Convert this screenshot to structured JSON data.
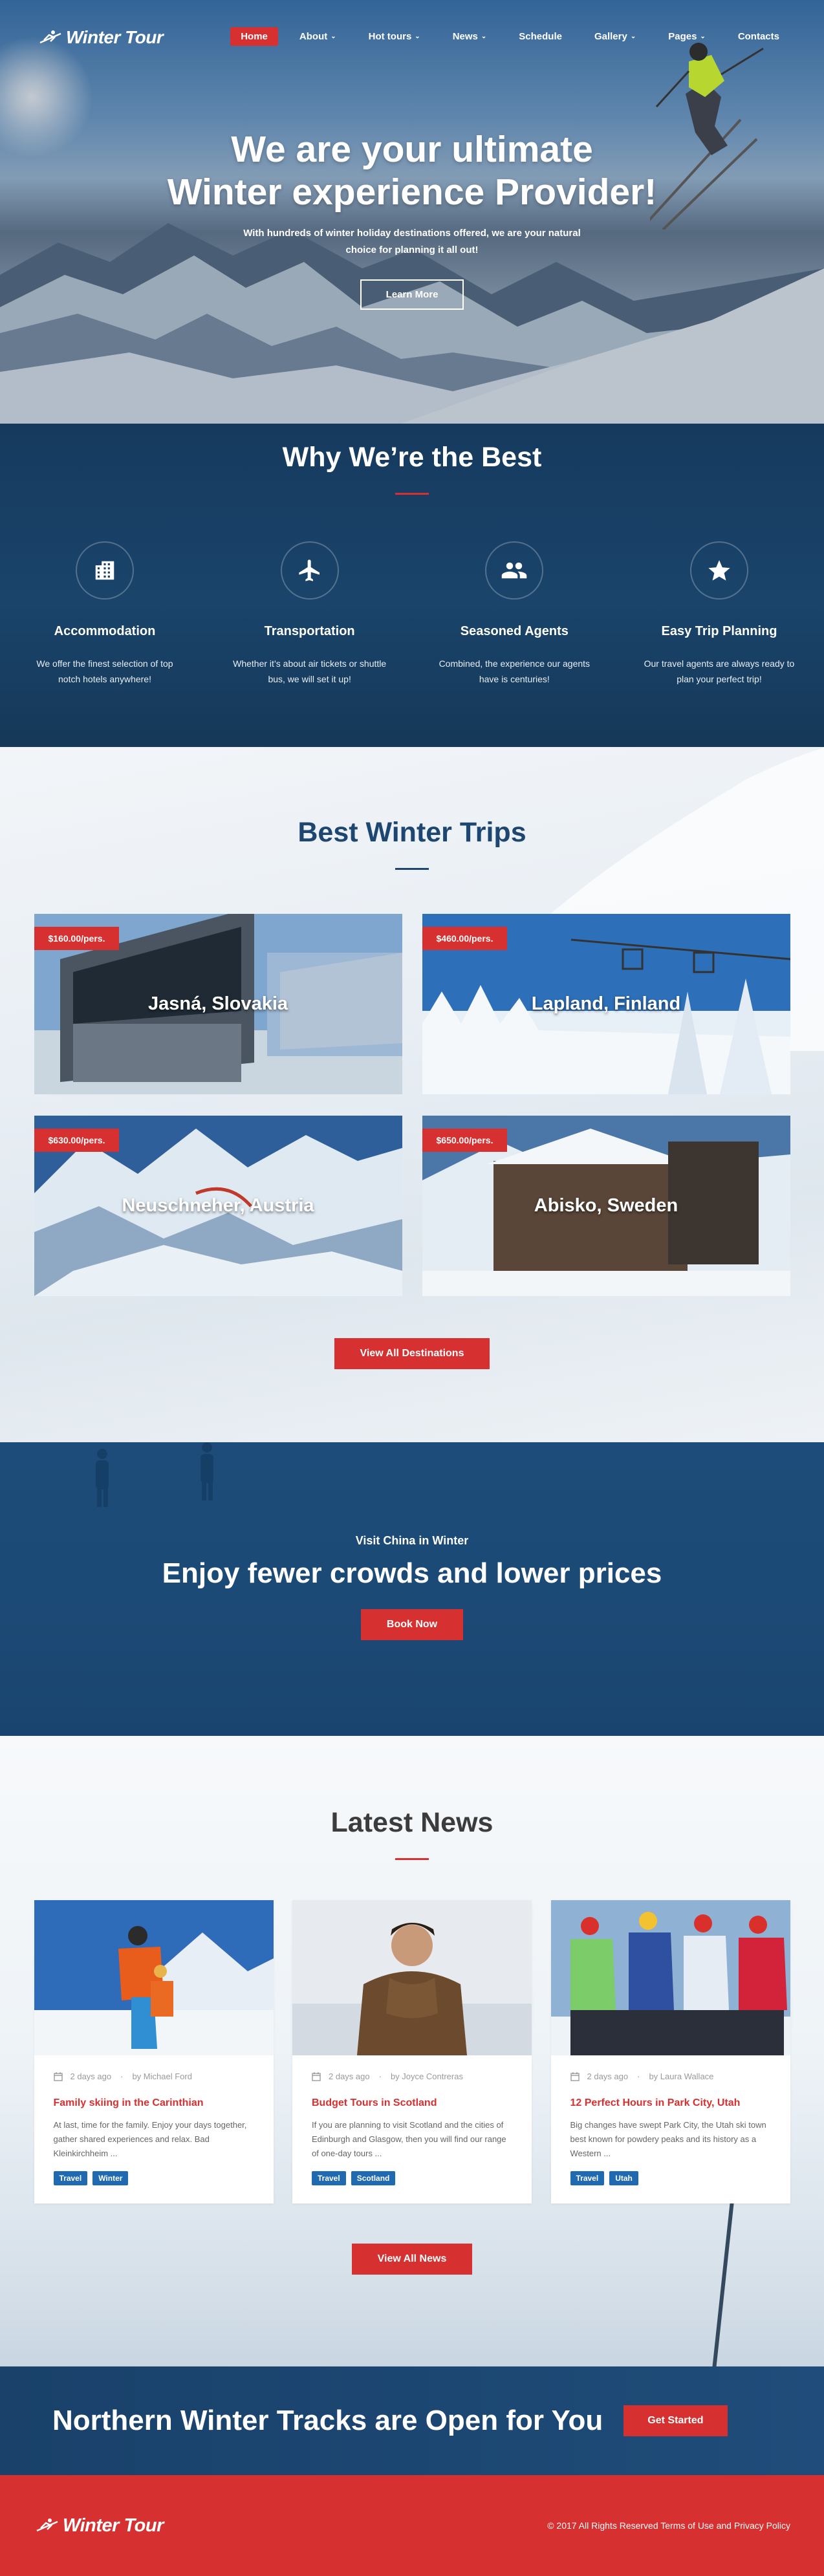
{
  "brand": {
    "name": "Winter Tour"
  },
  "nav": {
    "items": [
      {
        "label": "Home",
        "active": true,
        "dropdown": false
      },
      {
        "label": "About",
        "active": false,
        "dropdown": true
      },
      {
        "label": "Hot tours",
        "active": false,
        "dropdown": true
      },
      {
        "label": "News",
        "active": false,
        "dropdown": true
      },
      {
        "label": "Schedule",
        "active": false,
        "dropdown": false
      },
      {
        "label": "Gallery",
        "active": false,
        "dropdown": true
      },
      {
        "label": "Pages",
        "active": false,
        "dropdown": true
      },
      {
        "label": "Contacts",
        "active": false,
        "dropdown": false
      }
    ]
  },
  "hero": {
    "title_line1": "We are your ultimate",
    "title_line2": "Winter experience Provider!",
    "subtitle": "With hundreds of winter holiday destinations offered, we are your natural choice for planning it all out!",
    "button": "Learn More"
  },
  "why": {
    "title": "Why We’re the Best",
    "features": [
      {
        "icon": "building-icon",
        "title": "Accommodation",
        "text": "We offer the finest selection of top notch hotels anywhere!"
      },
      {
        "icon": "airplane-icon",
        "title": "Transportation",
        "text": "Whether it’s about air tickets or shuttle bus, we will set it up!"
      },
      {
        "icon": "people-icon",
        "title": "Seasoned Agents",
        "text": "Combined, the experience our agents have is centuries!"
      },
      {
        "icon": "star-icon",
        "title": "Easy Trip Planning",
        "text": "Our travel agents are always ready to plan your perfect trip!"
      }
    ]
  },
  "trips": {
    "title": "Best Winter Trips",
    "items": [
      {
        "price": "$160.00/pers.",
        "name": "Jasná, Slovakia"
      },
      {
        "price": "$460.00/pers.",
        "name": "Lapland, Finland"
      },
      {
        "price": "$630.00/pers.",
        "name": "Neuschneher, Austria"
      },
      {
        "price": "$650.00/pers.",
        "name": "Abisko, Sweden"
      }
    ],
    "button": "View All Destinations"
  },
  "promo": {
    "subtitle": "Visit China in Winter",
    "title": "Enjoy fewer crowds and lower prices",
    "button": "Book Now"
  },
  "news": {
    "title": "Latest News",
    "items": [
      {
        "date": "2 days ago",
        "author": "by Michael Ford",
        "title": "Family skiing in the Carinthian",
        "text": "At last, time for the family. Enjoy your days together, gather shared experiences and relax. Bad Kleinkirchheim ...",
        "tags": [
          "Travel",
          "Winter"
        ]
      },
      {
        "date": "2 days ago",
        "author": "by Joyce Contreras",
        "title": "Budget Tours in Scotland",
        "text": "If you are planning to visit Scotland and the cities of Edinburgh and Glasgow, then you will find our range of one-day tours ...",
        "tags": [
          "Travel",
          "Scotland"
        ]
      },
      {
        "date": "2 days ago",
        "author": "by Laura Wallace",
        "title": "12 Perfect Hours in Park City, Utah",
        "text": "Big changes have swept Park City, the Utah ski town best known for powdery peaks and its history as a Western ...",
        "tags": [
          "Travel",
          "Utah"
        ]
      }
    ],
    "button": "View All News"
  },
  "cta": {
    "title": "Northern Winter Tracks are Open for You",
    "button": "Get Started"
  },
  "footer": {
    "copyright": "© 2017 All Rights Reserved Terms of Use and Privacy Policy"
  },
  "colors": {
    "accent": "#d63031",
    "navy": "#163a5e",
    "tag": "#1f6ab0"
  }
}
